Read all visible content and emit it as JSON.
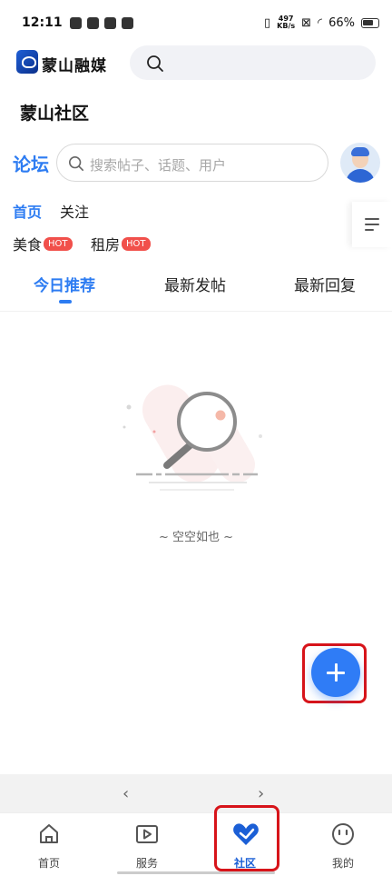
{
  "status_bar": {
    "time": "12:11",
    "net_speed": "497",
    "net_unit": "KB/s",
    "battery": "66%"
  },
  "header": {
    "app_name": "蒙山融媒",
    "search_icon": "search-icon"
  },
  "section_title": "蒙山社区",
  "forum": {
    "label": "论坛",
    "search_placeholder": "搜索帖子、话题、用户"
  },
  "tabs": {
    "home": "首页",
    "follow": "关注"
  },
  "categories": [
    {
      "label": "美食",
      "badge": "HOT"
    },
    {
      "label": "租房",
      "badge": "HOT"
    }
  ],
  "sub_tabs": [
    "今日推荐",
    "最新发帖",
    "最新回复"
  ],
  "empty_text": "~ 空空如也 ~",
  "colors": {
    "accent": "#2d7cf2",
    "highlight": "#d7141a",
    "badge": "#f1504b"
  },
  "browser_nav": {
    "back": "‹",
    "forward": "›"
  },
  "bottom_nav": [
    {
      "label": "首页",
      "icon": "home-icon"
    },
    {
      "label": "服务",
      "icon": "play-icon"
    },
    {
      "label": "社区",
      "icon": "heart-icon"
    },
    {
      "label": "我的",
      "icon": "smile-icon"
    }
  ]
}
